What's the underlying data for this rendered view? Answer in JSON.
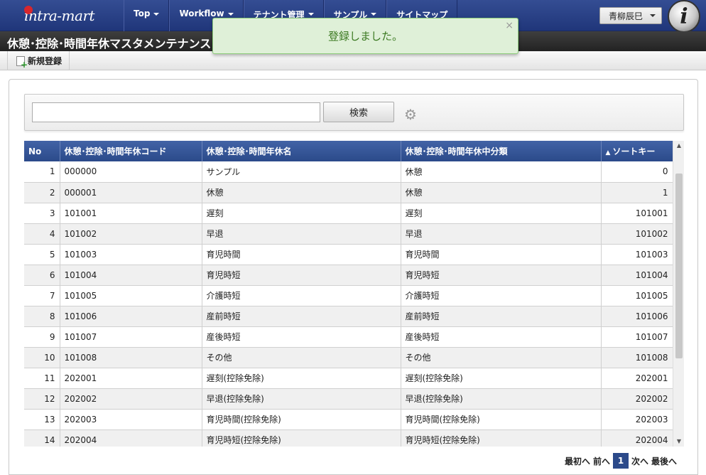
{
  "header": {
    "logo_text": "intra-mart",
    "nav": [
      {
        "label": "Top"
      },
      {
        "label": "Workflow"
      },
      {
        "label": "テナント管理"
      },
      {
        "label": "サンプル"
      },
      {
        "label": "サイトマップ"
      }
    ],
    "user_name": "青柳辰巳",
    "avatar_glyph": "i"
  },
  "title": "休憩･控除･時間年休マスタメンテナンス",
  "toolbar": {
    "new_label": "新規登録"
  },
  "toast": {
    "message": "登録しました。",
    "close_glyph": "×"
  },
  "search": {
    "value": "",
    "button_label": "検索"
  },
  "table": {
    "columns": [
      "No",
      "休憩･控除･時間年休コード",
      "休憩･控除･時間年休名",
      "休憩･控除･時間年休中分類",
      "ソートキー"
    ],
    "sort_indicator": "▲",
    "rows": [
      [
        "1",
        "000000",
        "サンプル",
        "休憩",
        "0"
      ],
      [
        "2",
        "000001",
        "休憩",
        "休憩",
        "1"
      ],
      [
        "3",
        "101001",
        "遅刻",
        "遅刻",
        "101001"
      ],
      [
        "4",
        "101002",
        "早退",
        "早退",
        "101002"
      ],
      [
        "5",
        "101003",
        "育児時間",
        "育児時間",
        "101003"
      ],
      [
        "6",
        "101004",
        "育児時短",
        "育児時短",
        "101004"
      ],
      [
        "7",
        "101005",
        "介護時短",
        "介護時短",
        "101005"
      ],
      [
        "8",
        "101006",
        "産前時短",
        "産前時短",
        "101006"
      ],
      [
        "9",
        "101007",
        "産後時短",
        "産後時短",
        "101007"
      ],
      [
        "10",
        "101008",
        "その他",
        "その他",
        "101008"
      ],
      [
        "11",
        "202001",
        "遅刻(控除免除)",
        "遅刻(控除免除)",
        "202001"
      ],
      [
        "12",
        "202002",
        "早退(控除免除)",
        "早退(控除免除)",
        "202002"
      ],
      [
        "13",
        "202003",
        "育児時間(控除免除)",
        "育児時間(控除免除)",
        "202003"
      ],
      [
        "14",
        "202004",
        "育児時短(控除免除)",
        "育児時短(控除免除)",
        "202004"
      ]
    ]
  },
  "pager": {
    "first": "最初へ",
    "prev": "前へ",
    "current": "1",
    "next": "次へ",
    "last": "最後へ"
  }
}
